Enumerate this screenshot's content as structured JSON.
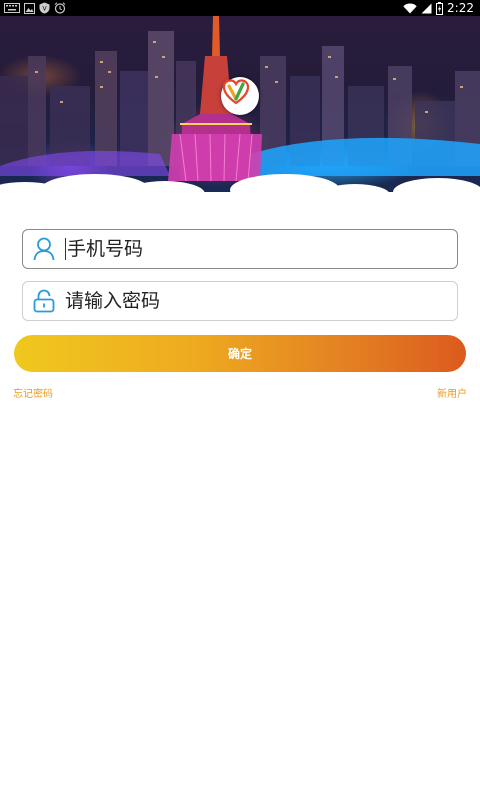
{
  "status_bar": {
    "time": "2:22",
    "left_icons": [
      "keyboard-icon",
      "image-icon",
      "vpn-shield-icon",
      "alarm-icon"
    ],
    "right_icons": [
      "wifi-icon",
      "cell-signal-icon",
      "battery-charging-icon"
    ]
  },
  "banner": {
    "image": "night-city-tower-photo",
    "logo_icon": "heart-v-logo-icon"
  },
  "login_form": {
    "phone_field": {
      "placeholder": "手机号码",
      "value": "",
      "icon": "user-icon",
      "focused": true
    },
    "password_field": {
      "placeholder": "请输入密码",
      "value": "",
      "icon": "lock-icon"
    },
    "confirm_button": {
      "label": "确定"
    },
    "forgot_password_link": {
      "label": "忘记密码"
    },
    "new_user_link": {
      "label": "新用户"
    }
  },
  "colors": {
    "accent_start": "#f0c81e",
    "accent_end": "#dc5a1e",
    "link_color": "#ec9a1c",
    "icon_blue": "#2a9ad8",
    "status_bar_bg": "#000000"
  }
}
